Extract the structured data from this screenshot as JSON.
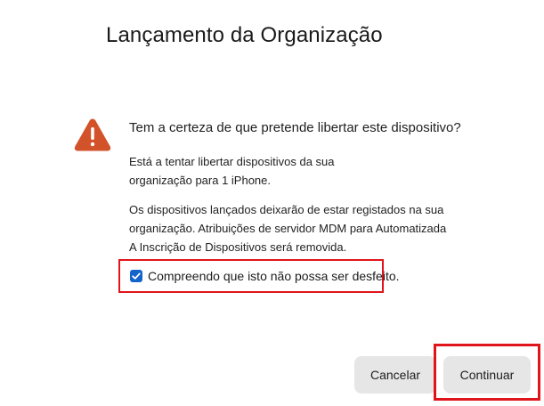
{
  "dialog": {
    "title": "Lançamento da Organização",
    "warning_icon": "warning-triangle-icon",
    "question": "Tem a certeza de que pretende libertar este dispositivo?",
    "paragraph1": {
      "line1": "Está a tentar libertar dispositivos da sua",
      "line2": "organização para 1 iPhone."
    },
    "paragraph2": {
      "line1": "Os dispositivos lançados deixarão de estar registados na sua",
      "line2": "organização. Atribuições de servidor MDM para Automatizada",
      "line3": "A Inscrição de Dispositivos será removida."
    },
    "confirm_checkbox": {
      "label": "Compreendo que isto não possa ser desfeito.",
      "checked": true
    },
    "buttons": {
      "cancel_label": "Cancelar",
      "continue_label": "Continuar"
    },
    "colors": {
      "warning": "#d2522a",
      "checkbox": "#1463c9",
      "highlight": "#e0151b",
      "button_bg": "#e6e6e6"
    }
  }
}
